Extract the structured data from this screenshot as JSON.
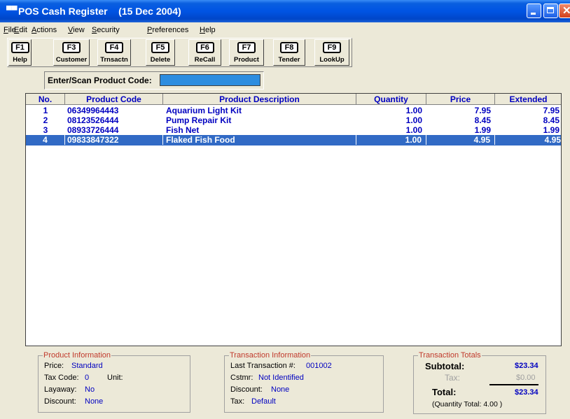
{
  "window": {
    "title": "POS Cash Register    (15 Dec 2004)",
    "app_icon": "register-icon"
  },
  "menu": [
    "File",
    "Edit",
    "Actions",
    "View",
    "Security",
    "Preferences",
    "Help"
  ],
  "toolbar": [
    {
      "key": "F1",
      "label": "Help"
    },
    {
      "key": "F3",
      "label": "Customer"
    },
    {
      "key": "F4",
      "label": "Trnsactn"
    },
    {
      "key": "F5",
      "label": "Delete"
    },
    {
      "key": "F6",
      "label": "ReCall"
    },
    {
      "key": "F7",
      "label": "Product"
    },
    {
      "key": "F8",
      "label": "Tender"
    },
    {
      "key": "F9",
      "label": "LookUp"
    }
  ],
  "scan": {
    "label": "Enter/Scan Product Code:",
    "value": ""
  },
  "grid": {
    "headers": [
      "No.",
      "Product Code",
      "Product Description",
      "Quantity",
      "Price",
      "Extended"
    ],
    "rows": [
      {
        "no": "1",
        "code": "06349964443",
        "desc": "Aquarium Light Kit",
        "qty": "1.00",
        "price": "7.95",
        "ext": "7.95"
      },
      {
        "no": "2",
        "code": "08123526444",
        "desc": "Pump Repair Kit",
        "qty": "1.00",
        "price": "8.45",
        "ext": "8.45"
      },
      {
        "no": "3",
        "code": "08933726444",
        "desc": "Fish Net",
        "qty": "1.00",
        "price": "1.99",
        "ext": "1.99"
      },
      {
        "no": "4",
        "code": "09833847322",
        "desc": "Flaked Fish Food",
        "qty": "1.00",
        "price": "4.95",
        "ext": "4.95"
      }
    ],
    "selected_row": 3
  },
  "product_info": {
    "title": "Product Information",
    "price_label": "Price:",
    "price_value": "Standard",
    "taxcode_label": "Tax Code:",
    "taxcode_value": "0",
    "unit_label": "Unit:",
    "layaway_label": "Layaway:",
    "layaway_value": "No",
    "discount_label": "Discount:",
    "discount_value": "None"
  },
  "transaction_info": {
    "title": "Transaction Information",
    "last_label": "Last Transaction #:",
    "last_value": "001002",
    "cstmr_label": "Cstmr:",
    "cstmr_value": "Not Identified",
    "discount_label": "Discount:",
    "discount_value": "None",
    "tax_label": "Tax:",
    "tax_value": "Default"
  },
  "totals": {
    "title": "Transaction Totals",
    "subtotal_label": "Subtotal:",
    "subtotal_value": "$23.34",
    "tax_label": "Tax:",
    "tax_value": "$0.00",
    "total_label": "Total:",
    "total_value": "$23.34",
    "quantity_total": "(Quantity Total: 4.00 )"
  },
  "colors": {
    "titlebar": "#0054e3",
    "grid_text": "#0000c0",
    "selection": "#316ac5",
    "scan_field": "#2d8de0",
    "panel_title": "#c0392b"
  }
}
